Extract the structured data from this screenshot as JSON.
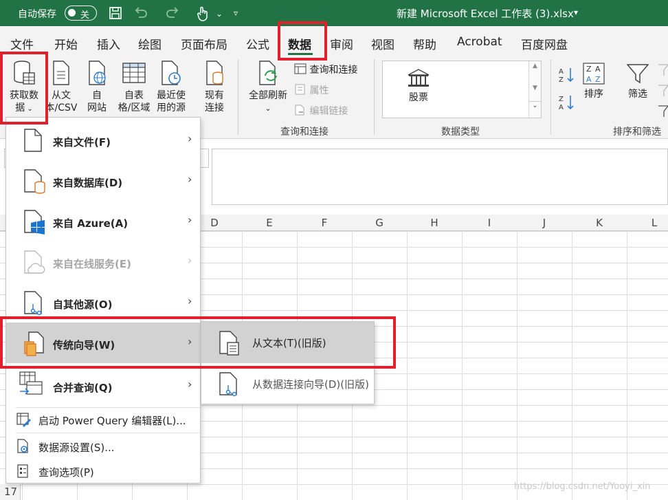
{
  "titlebar": {
    "autosave_label": "自动保存",
    "autosave_state": "关",
    "document_title": "新建 Microsoft Excel 工作表 (3).xlsx",
    "bg_color": "#217346"
  },
  "tabs": [
    {
      "label": "文件"
    },
    {
      "label": "开始"
    },
    {
      "label": "插入"
    },
    {
      "label": "绘图"
    },
    {
      "label": "页面布局"
    },
    {
      "label": "公式"
    },
    {
      "label": "数据",
      "active": true
    },
    {
      "label": "审阅"
    },
    {
      "label": "视图"
    },
    {
      "label": "帮助"
    },
    {
      "label": "Acrobat"
    },
    {
      "label": "百度网盘"
    }
  ],
  "ribbon": {
    "get_data": {
      "line1": "获取数",
      "line2": "据"
    },
    "from_text": {
      "line1": "从文",
      "line2": "本/CSV"
    },
    "from_web": {
      "line1": "自",
      "line2": "网站"
    },
    "from_table": {
      "line1": "自表",
      "line2": "格/区域"
    },
    "recent_sources": {
      "line1": "最近使",
      "line2": "用的源"
    },
    "existing_conn": {
      "line1": "现有",
      "line2": "连接"
    },
    "refresh_all": {
      "line1": "全部刷新"
    },
    "queries_connections": "查询和连接",
    "properties": "属性",
    "edit_links": "编辑链接",
    "group_queries": "查询和连接",
    "stocks": "股票",
    "group_datatypes": "数据类型",
    "sort": "排序",
    "filter": "筛选",
    "group_sort_filter": "排序和筛选"
  },
  "columns": [
    "D",
    "E",
    "F",
    "G",
    "H",
    "I",
    "J",
    "K",
    "L"
  ],
  "row_17": "17",
  "menu": {
    "items": [
      {
        "label": "来自文件(F)",
        "icon": "file-icon"
      },
      {
        "label": "来自数据库(D)",
        "icon": "database-icon"
      },
      {
        "label": "来自 Azure(A)",
        "icon": "azure-icon"
      },
      {
        "label": "来自在线服务(E)",
        "icon": "cloud-icon",
        "disabled": true
      },
      {
        "label": "自其他源(O)",
        "icon": "other-source-icon"
      },
      {
        "label": "传统向导(W)",
        "icon": "legacy-wizard-icon"
      },
      {
        "label": "合并查询(Q)",
        "icon": "combine-icon"
      }
    ],
    "small_items": [
      {
        "label": "启动 Power Query 编辑器(L)..."
      },
      {
        "label": "数据源设置(S)..."
      },
      {
        "label": "查询选项(P)"
      }
    ]
  },
  "submenu": {
    "items": [
      {
        "label": "从文本(T)(旧版)"
      },
      {
        "label": "从数据连接向导(D)(旧版)"
      }
    ]
  },
  "watermark": "https://blog.csdn.net/Yooyi_xin",
  "accent_red": "#e0202a"
}
